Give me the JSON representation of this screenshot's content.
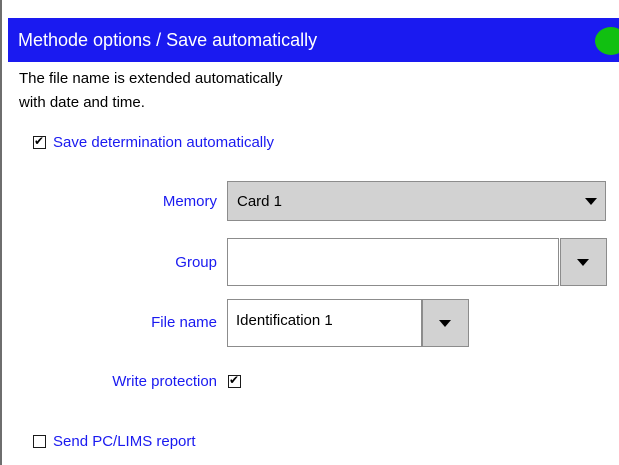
{
  "window": {
    "title": "Methode options / Save automatically",
    "status_color": "#11c011",
    "titlebar_color": "#1a1af0"
  },
  "info": {
    "line1": "The file name is extended automatically",
    "line2": "with date and time."
  },
  "save_determination": {
    "label": "Save determination automatically",
    "checked": true,
    "checkmark": "✔"
  },
  "memory": {
    "label": "Memory",
    "value": "Card 1"
  },
  "group": {
    "label": "Group",
    "value": ""
  },
  "file_name": {
    "label": "File name",
    "value": "Identification 1"
  },
  "write_protection": {
    "label": "Write protection",
    "checked": true,
    "checkmark": "✔"
  },
  "send_report": {
    "label": "Send PC/LIMS report",
    "checked": false
  }
}
